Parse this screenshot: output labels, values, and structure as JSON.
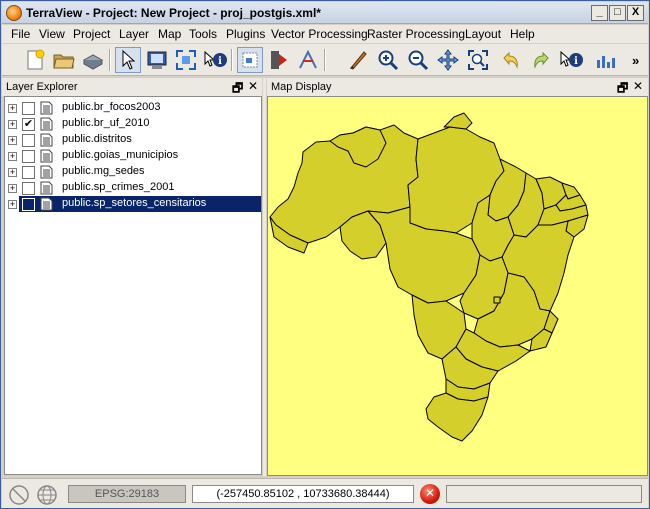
{
  "window": {
    "title": "TerraView - Project: New Project - proj_postgis.xml*",
    "controls": {
      "minimize": "_",
      "maximize": "□",
      "close": "X"
    }
  },
  "menubar": {
    "items": [
      "File",
      "View",
      "Project",
      "Layer",
      "Map",
      "Tools",
      "Plugins",
      "Vector Processing",
      "Raster Processing",
      "Layout",
      "Help"
    ]
  },
  "toolbar": {
    "icons": [
      "new-project-icon",
      "open-project-icon",
      "save-project-icon",
      "pointer-icon",
      "info-screen-icon",
      "zoom-extent-icon",
      "info-icon",
      "selection-icon",
      "measure-icon",
      "pan-arrow-icon",
      "pencil-icon",
      "zoom-in-icon",
      "zoom-out-icon",
      "pan-icon",
      "zoom-area-icon",
      "undo-icon",
      "redo-icon",
      "feature-info-icon",
      "chart-icon"
    ],
    "overflow": "»"
  },
  "layer_explorer": {
    "title": "Layer Explorer",
    "layers": [
      {
        "name": "public.br_focos2003",
        "checked": false,
        "selected": false
      },
      {
        "name": "public.br_uf_2010",
        "checked": true,
        "selected": false
      },
      {
        "name": "public.distritos",
        "checked": false,
        "selected": false
      },
      {
        "name": "public.goias_municipios",
        "checked": false,
        "selected": false
      },
      {
        "name": "public.mg_sedes",
        "checked": false,
        "selected": false
      },
      {
        "name": "public.sp_crimes_2001",
        "checked": false,
        "selected": false
      },
      {
        "name": "public.sp_setores_censitarios",
        "checked": false,
        "selected": true
      }
    ],
    "expander_symbol": "+",
    "check_symbol": "✔"
  },
  "map_display": {
    "title": "Map Display",
    "background_color": "#ffff80",
    "fill_color": "#d4cf2a"
  },
  "panel_controls": {
    "float": "🗗",
    "close": "✕"
  },
  "statusbar": {
    "epsg": "EPSG:29183",
    "coordinates": "(-257450.85102 , 10733680.38444)",
    "stop_symbol": "✕"
  }
}
